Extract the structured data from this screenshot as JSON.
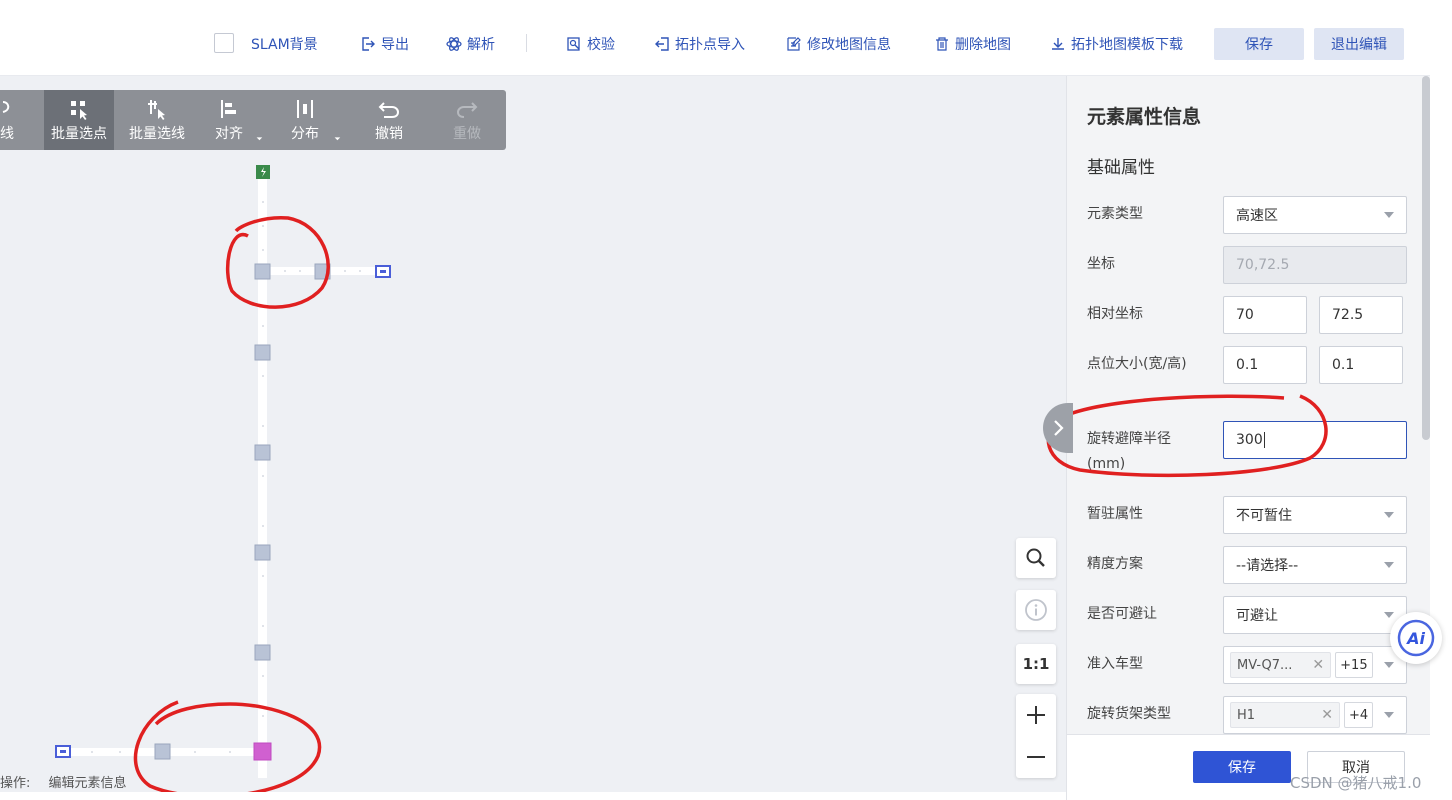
{
  "topbar": {
    "slam_label": "SLAM背景",
    "export_label": "导出",
    "parse_label": "解析",
    "verify_label": "校验",
    "import_points_label": "拓扑点导入",
    "edit_map_info_label": "修改地图信息",
    "delete_map_label": "删除地图",
    "download_template_label": "拓扑地图模板下载",
    "save_label": "保存",
    "exit_edit_label": "退出编辑"
  },
  "edit_toolbar": {
    "line_label": "连线",
    "batch_point_label": "批量选点",
    "batch_line_label": "批量选线",
    "align_label": "对齐",
    "distribute_label": "分布",
    "undo_label": "撤销",
    "redo_label": "重做"
  },
  "status": {
    "op_prefix": "操作:",
    "op_value": "编辑元素信息"
  },
  "controls": {
    "one_to_one_label": "1:1"
  },
  "panel": {
    "title": "元素属性信息",
    "section": "基础属性",
    "element_type": {
      "label": "元素类型",
      "value": "高速区"
    },
    "coord": {
      "label": "坐标",
      "placeholder": "70,72.5"
    },
    "relative_coord": {
      "label": "相对坐标",
      "x": "70",
      "y": "72.5"
    },
    "point_size": {
      "label": "点位大小(宽/高)",
      "w": "0.1",
      "h": "0.1"
    },
    "rotate_radius": {
      "label": "旋转避障半径(mm)",
      "value": "300"
    },
    "stay_attr": {
      "label": "暂驻属性",
      "value": "不可暂住"
    },
    "precision": {
      "label": "精度方案",
      "value": "--请选择--"
    },
    "avoidable": {
      "label": "是否可避让",
      "value": "可避让"
    },
    "vehicle": {
      "label": "准入车型",
      "tag": "MV-Q7...",
      "count": "+15"
    },
    "shelf": {
      "label": "旋转货架类型",
      "tag": "H1",
      "count": "+4"
    },
    "save_label": "保存",
    "cancel_label": "取消"
  },
  "ai_label": "Ai",
  "watermark": "CSDN @猪八戒1.0",
  "colors": {
    "accent": "#2f54d5",
    "annotation": "#e02020",
    "node_fill": "#b9c3d6",
    "selected_node": "#d060d0",
    "charge_node": "#3a8a4a"
  }
}
